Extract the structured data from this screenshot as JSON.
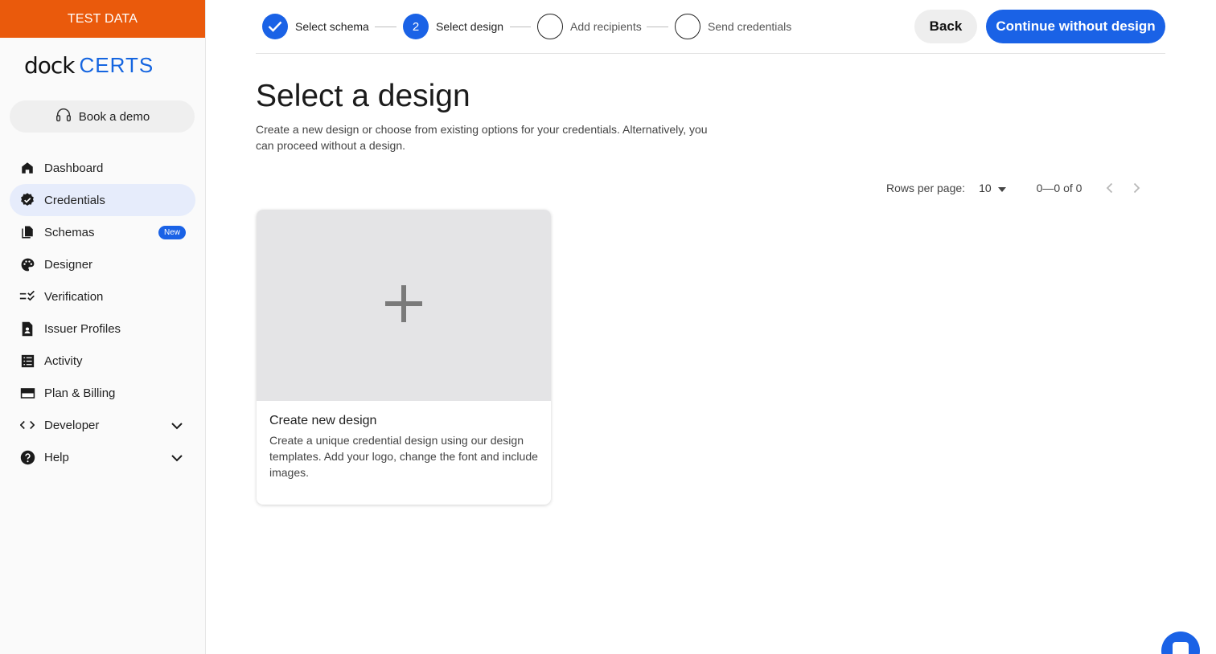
{
  "sidebar": {
    "test_banner": "TEST DATA",
    "logo_dock": "dock",
    "logo_certs": "CERTS",
    "demo_button": "Book a demo",
    "items": [
      {
        "label": "Dashboard",
        "icon": "home-icon"
      },
      {
        "label": "Credentials",
        "icon": "verified-badge-icon",
        "active": true
      },
      {
        "label": "Schemas",
        "icon": "documents-icon",
        "badge": "New"
      },
      {
        "label": "Designer",
        "icon": "palette-icon"
      },
      {
        "label": "Verification",
        "icon": "checklist-icon"
      },
      {
        "label": "Issuer Profiles",
        "icon": "contact-document-icon"
      },
      {
        "label": "Activity",
        "icon": "list-icon"
      },
      {
        "label": "Plan & Billing",
        "icon": "credit-card-icon"
      },
      {
        "label": "Developer",
        "icon": "code-icon",
        "expandable": true
      },
      {
        "label": "Help",
        "icon": "help-icon",
        "expandable": true
      }
    ]
  },
  "stepper": {
    "steps": [
      {
        "label": "Select schema",
        "state": "done"
      },
      {
        "label": "Select design",
        "state": "current",
        "number": "2"
      },
      {
        "label": "Add recipients",
        "state": "todo"
      },
      {
        "label": "Send credentials",
        "state": "todo"
      }
    ],
    "back_label": "Back",
    "continue_label": "Continue without design"
  },
  "main": {
    "title": "Select a design",
    "subtitle": "Create a new design or choose from existing options for your credentials. Alternatively, you can proceed without a design.",
    "pagination": {
      "rows_label": "Rows per page:",
      "rows_value": "10",
      "range": "0—0 of 0"
    },
    "card": {
      "title": "Create new design",
      "description": "Create a unique credential design using our design templates. Add your logo, change the font and include images."
    }
  },
  "colors": {
    "accent": "#1a62e6",
    "banner": "#ea5a0c",
    "active_nav": "#e6ecfb"
  }
}
